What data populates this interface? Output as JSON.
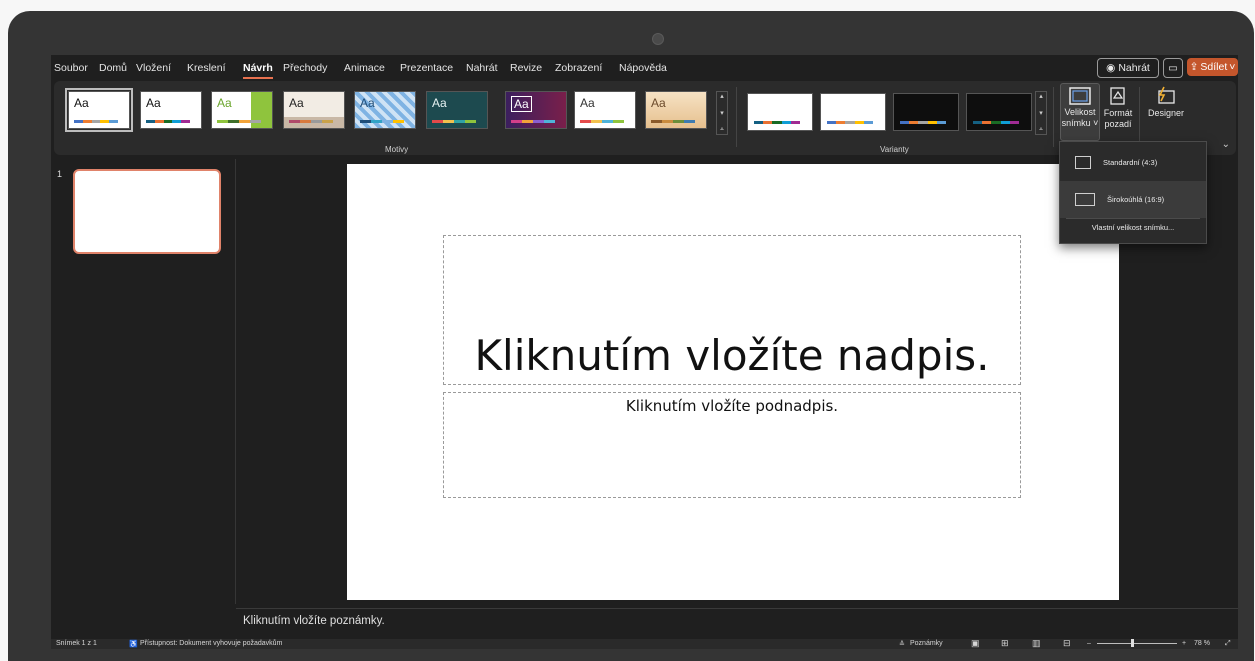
{
  "menu": {
    "tabs": [
      "Soubor",
      "Domů",
      "Vložení",
      "Kreslení",
      "Návrh",
      "Přechody",
      "Animace",
      "Prezentace",
      "Nahrát",
      "Revize",
      "Zobrazení",
      "Nápověda"
    ],
    "active_tab": "Návrh",
    "record_label": "Nahrát",
    "share_label": "Sdílet"
  },
  "ribbon": {
    "themes_group_label": "Motivy",
    "variants_group_label": "Varianty",
    "theme_sample_text": "Aa",
    "slide_size_label_line1": "Velikost",
    "slide_size_label_line2": "snímku ˅",
    "format_background_line1": "Formát",
    "format_background_line2": "pozadí",
    "designer_label": "Designer"
  },
  "slide_size_menu": {
    "options": [
      "Standardní (4:3)",
      "Širokoúhlá (16:9)"
    ],
    "highlighted_option": "Širokoúhlá (16:9)",
    "custom_label": "Vlastní velikost snímku..."
  },
  "thumbnails": {
    "slide_number": "1"
  },
  "slide": {
    "title_placeholder": "Kliknutím vložíte nadpis.",
    "subtitle_placeholder": "Kliknutím vložíte podnadpis."
  },
  "notes": {
    "placeholder": "Kliknutím vložíte poznámky."
  },
  "statusbar": {
    "slide_counter": "Snímek 1 z 1",
    "accessibility": "Přístupnost: Dokument vyhovuje požadavkům",
    "notes_button": "Poznámky",
    "zoom": "78 %"
  }
}
